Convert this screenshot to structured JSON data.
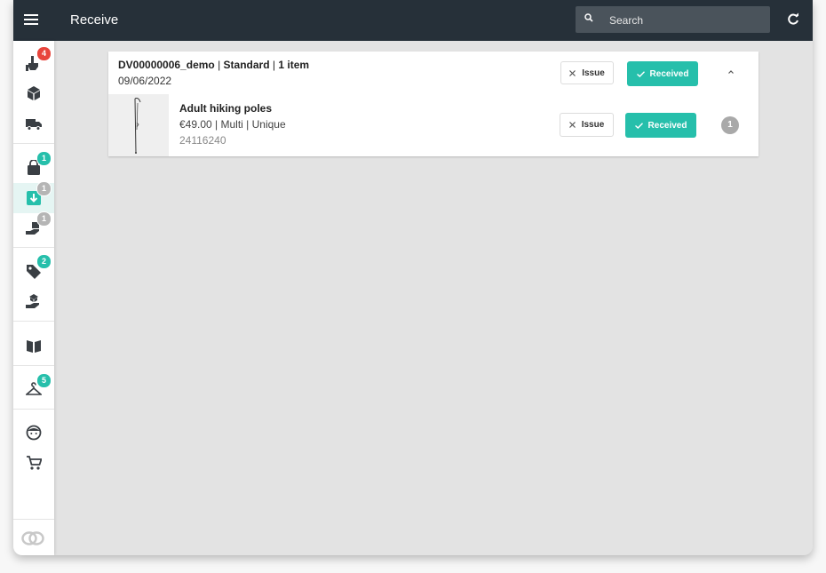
{
  "header": {
    "title": "Receive",
    "menu_icon": "hamburger-icon",
    "refresh_icon": "refresh-icon"
  },
  "search": {
    "placeholder": "Search",
    "icon": "search-icon"
  },
  "sidebar": {
    "items": [
      {
        "icon": "hand-pointer-icon",
        "badge": "4",
        "badge_color": "#e8453c"
      },
      {
        "icon": "box-icon",
        "badge": ""
      },
      {
        "icon": "truck-icon",
        "badge": ""
      },
      {
        "icon": "shopping-bag-icon",
        "badge": "1",
        "badge_color": "#26bfab"
      },
      {
        "icon": "receive-download-icon",
        "badge": "1",
        "badge_color": "#b5b5b5",
        "active": true
      },
      {
        "icon": "hand-give-icon",
        "badge": "1",
        "badge_color": "#b5b5b5"
      },
      {
        "icon": "tags-icon",
        "badge": "2",
        "badge_color": "#26bfab"
      },
      {
        "icon": "hand-box-icon",
        "badge": ""
      },
      {
        "icon": "book-open-icon",
        "badge": ""
      },
      {
        "icon": "hanger-icon",
        "badge": "5",
        "badge_color": "#26bfab"
      },
      {
        "icon": "face-icon",
        "badge": ""
      },
      {
        "icon": "cart-icon",
        "badge": ""
      }
    ],
    "logo": "brand-logo-icon"
  },
  "order": {
    "id": "DV00000006_demo",
    "type": "Standard",
    "count": "1 item",
    "date": "09/06/2022",
    "issue_label": "Issue",
    "received_label": "Received"
  },
  "item": {
    "name": "Adult hiking poles",
    "meta": "€49.00 | Multi | Unique",
    "code": "24116240",
    "issue_label": "Issue",
    "received_label": "Received",
    "quantity": "1"
  },
  "colors": {
    "accent": "#26bfab",
    "topbar": "#263039",
    "alert": "#e8453c"
  }
}
